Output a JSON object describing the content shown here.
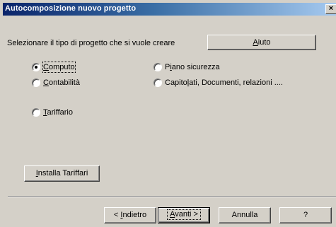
{
  "window": {
    "title": "Autocomposizione nuovo progetto",
    "close_glyph": "×"
  },
  "prompt": "Selezionare il tipo di progetto che si vuole creare",
  "help_button": {
    "pre": "",
    "u": "A",
    "post": "iuto"
  },
  "options": {
    "computo": {
      "pre": "",
      "u": "C",
      "post": "omputo",
      "selected": true
    },
    "contabilita": {
      "pre": "",
      "u": "C",
      "post": "ontabilità",
      "selected": false
    },
    "tariffario": {
      "pre": "",
      "u": "T",
      "post": "ariffario",
      "selected": false
    },
    "piano_sicurezza": {
      "pre": "P",
      "u": "i",
      "post": "ano sicurezza",
      "selected": false
    },
    "capitolati": {
      "pre": "Capito",
      "u": "l",
      "post": "ati, Documenti, relazioni ....",
      "selected": false
    }
  },
  "install_button": {
    "pre": "",
    "u": "I",
    "post": "nstalla Tariffari"
  },
  "nav": {
    "back": {
      "pre": "< ",
      "u": "I",
      "post": "ndietro"
    },
    "next": {
      "pre": "",
      "u": "A",
      "post": "vanti >"
    },
    "cancel": "Annulla",
    "help": "?"
  },
  "icons": {
    "close": "close-icon",
    "radio_selected": "radio-selected-icon",
    "radio_unselected": "radio-unselected-icon"
  },
  "colors": {
    "titlebar_start": "#0a246a",
    "titlebar_end": "#a6caf0",
    "dialog_bg": "#d4d0c8"
  }
}
